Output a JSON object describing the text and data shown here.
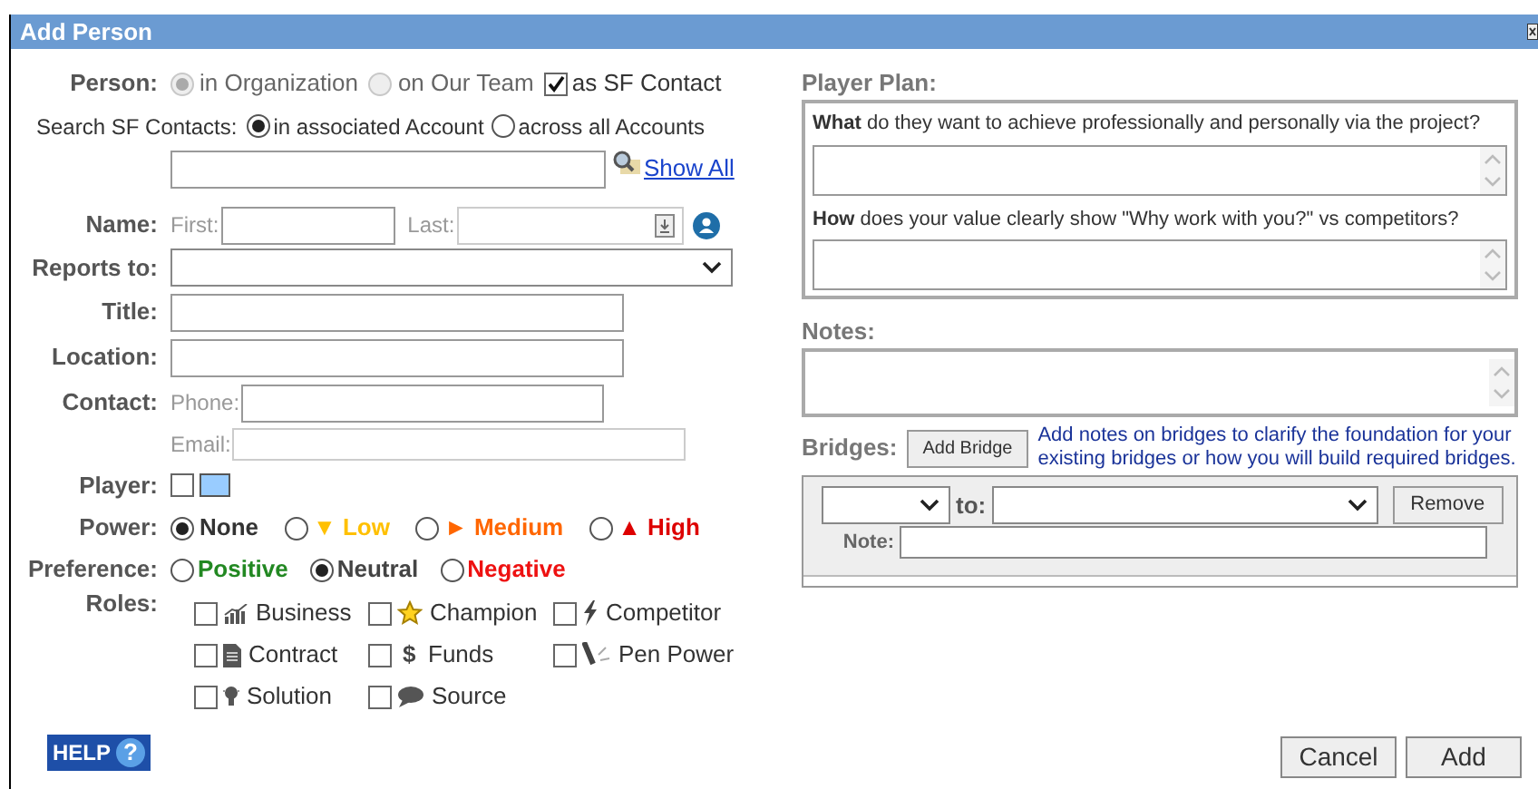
{
  "window": {
    "title": "Add Person"
  },
  "person": {
    "label": "Person:",
    "options": [
      {
        "label": "in Organization",
        "selected": true,
        "disabled": true
      },
      {
        "label": "on Our Team",
        "selected": false,
        "disabled": true
      }
    ],
    "sf_contact": {
      "label": "as SF Contact",
      "checked": true
    }
  },
  "search": {
    "label": "Search SF Contacts:",
    "options": [
      {
        "label": "in associated Account",
        "selected": true
      },
      {
        "label": "across all Accounts",
        "selected": false
      }
    ],
    "show_all": "Show All"
  },
  "name": {
    "label": "Name:",
    "first_label": "First:",
    "last_label": "Last:"
  },
  "reports_to": {
    "label": "Reports to:"
  },
  "title": {
    "label": "Title:"
  },
  "location": {
    "label": "Location:"
  },
  "contact": {
    "label": "Contact:",
    "phone_label": "Phone:",
    "email_label": "Email:"
  },
  "player": {
    "label": "Player:",
    "checked": false
  },
  "power": {
    "label": "Power:",
    "options": [
      {
        "label": "None",
        "selected": true,
        "color": "#333333"
      },
      {
        "label": "Low",
        "symbol": "▼",
        "selected": false,
        "color": "#ffc000"
      },
      {
        "label": "Medium",
        "symbol": "►",
        "selected": false,
        "color": "#ff6600"
      },
      {
        "label": "High",
        "symbol": "▲",
        "selected": false,
        "color": "#dd0000"
      }
    ]
  },
  "preference": {
    "label": "Preference:",
    "options": [
      {
        "label": "Positive",
        "selected": false,
        "color": "#228822"
      },
      {
        "label": "Neutral",
        "selected": true,
        "color": "#444444"
      },
      {
        "label": "Negative",
        "selected": false,
        "color": "#ee1111"
      }
    ]
  },
  "roles": {
    "label": "Roles:",
    "items": [
      {
        "label": "Business",
        "kind": "chart",
        "checked": false
      },
      {
        "label": "Champion",
        "kind": "star",
        "checked": false
      },
      {
        "label": "Competitor",
        "kind": "bolt",
        "checked": false
      },
      {
        "label": "Contract",
        "kind": "document",
        "checked": false
      },
      {
        "label": "Funds",
        "kind": "dollar",
        "symbol": "$",
        "checked": false
      },
      {
        "label": "Pen Power",
        "kind": "pen",
        "checked": false
      },
      {
        "label": "Solution",
        "kind": "bulb",
        "checked": false
      },
      {
        "label": "Source",
        "kind": "speech",
        "checked": false
      }
    ]
  },
  "player_plan": {
    "label": "Player Plan:",
    "questions": [
      {
        "text": "**What** do they want to achieve professionally and personally via the project?"
      },
      {
        "text": "**How** does your value clearly show \"Why work with you?\" vs competitors?"
      }
    ]
  },
  "notes": {
    "label": "Notes:"
  },
  "bridges": {
    "label": "Bridges:",
    "add_button": "Add Bridge",
    "hint": "Add notes on bridges to clarify the foundation for your existing bridges or how you will build required bridges.",
    "rows": [
      {
        "to_label": "to:",
        "remove_button": "Remove",
        "note_label": "Note:"
      }
    ]
  },
  "help": {
    "label": "HELP",
    "symbol": "?"
  },
  "buttons": [
    "Cancel",
    "Add"
  ]
}
